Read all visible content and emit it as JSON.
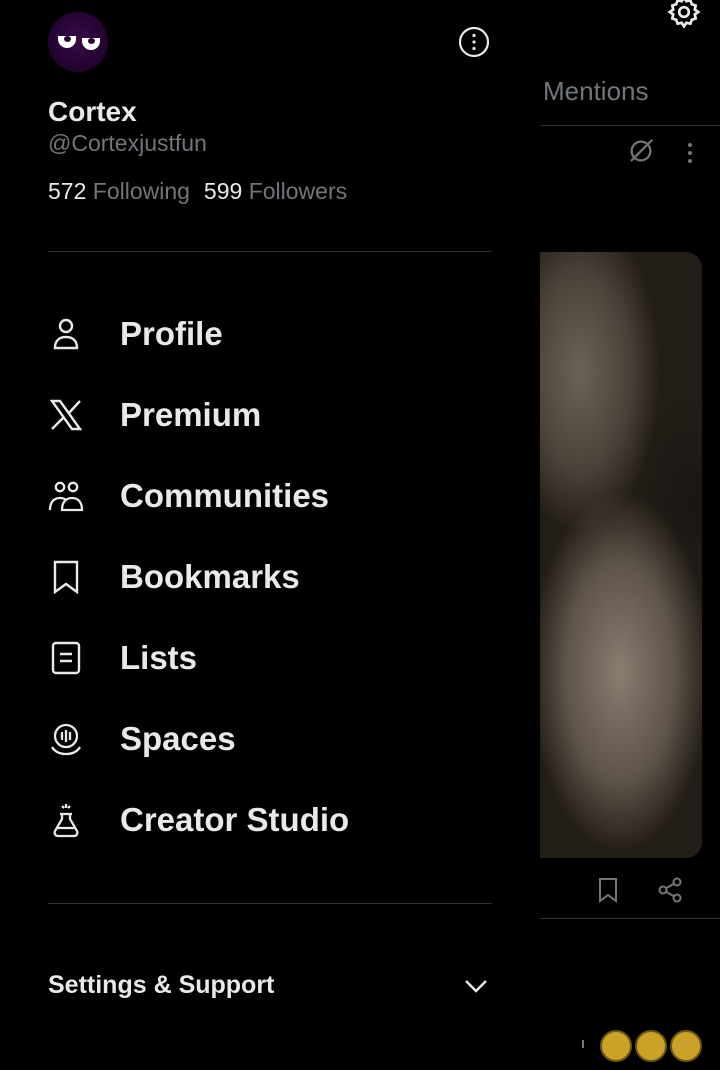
{
  "background": {
    "tab_label": "Mentions",
    "settings_icon": "gear-icon",
    "grok_icon": "grok-icon",
    "more_icon": "more-vertical-icon",
    "bookmark_icon": "bookmark-icon",
    "share_icon": "share-icon"
  },
  "profile": {
    "name": "Cortex",
    "handle": "@Cortexjustfun",
    "following_count": "572",
    "following_label": "Following",
    "followers_count": "599",
    "followers_label": "Followers",
    "avatar_color": "#240432"
  },
  "nav": {
    "items": [
      {
        "label": "Profile",
        "icon": "person-icon"
      },
      {
        "label": "Premium",
        "icon": "x-logo-icon"
      },
      {
        "label": "Communities",
        "icon": "communities-icon"
      },
      {
        "label": "Bookmarks",
        "icon": "bookmark-icon"
      },
      {
        "label": "Lists",
        "icon": "list-icon"
      },
      {
        "label": "Spaces",
        "icon": "spaces-icon"
      },
      {
        "label": "Creator Studio",
        "icon": "flask-icon"
      }
    ]
  },
  "footer": {
    "settings_support_label": "Settings & Support"
  },
  "colors": {
    "background": "#000000",
    "text_primary": "#e7e9ea",
    "text_secondary": "#71767b",
    "divider": "#2f3336"
  }
}
